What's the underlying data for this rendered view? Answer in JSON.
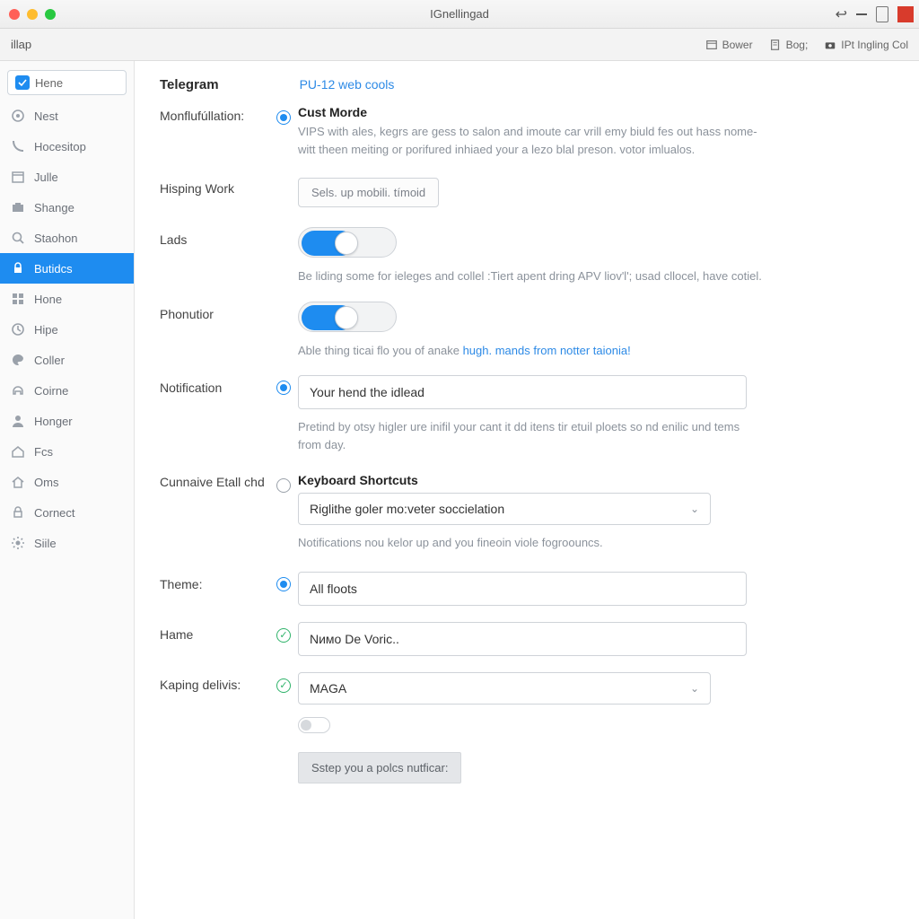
{
  "window": {
    "title": "IGnellingad"
  },
  "toolbar": {
    "brand": "illap",
    "buttons": {
      "bower": "Bower",
      "bog": "Bog;",
      "ingling": "IPt Ingling Col"
    }
  },
  "sidebar": {
    "search": "Hene",
    "items": [
      {
        "label": "Nest"
      },
      {
        "label": "Hocesitop"
      },
      {
        "label": "Julle"
      },
      {
        "label": "Shange"
      },
      {
        "label": "Staohon"
      },
      {
        "label": "Butidcs"
      },
      {
        "label": "Hone"
      },
      {
        "label": "Hipe"
      },
      {
        "label": "Coller"
      },
      {
        "label": "Coirne"
      },
      {
        "label": "Honger"
      },
      {
        "label": "Fcs"
      },
      {
        "label": "Oms"
      },
      {
        "label": "Cornect"
      },
      {
        "label": "Siile"
      }
    ]
  },
  "page": {
    "title": "Telegram",
    "link": "PU-12 web cools",
    "mode_label": "Monflufúllation:",
    "mode_title": "Cust Morde",
    "mode_desc": "VIPS with ales, kegrs are gess to salon and imoute car vrill emy biuld fes out hass nome-witt theen meiting or porifured inhiaed your a lezo blal preson. votor imlualos.",
    "hisping_label": "Hisping Work",
    "hisping_button": "Sels. up mobili. tímoid",
    "lads_label": "Lads",
    "lads_desc": "Be liding some for ieleges and collel :Tiert apent dring APV liov'l'; usad cllocel, have cotiel.",
    "phon_label": "Phonutior",
    "phon_desc_pre": "Able thing ticai flo you of anake ",
    "phon_desc_link": "hugh. mands from notter taionia!",
    "notif_label": "Notification",
    "notif_value": "Your hend the idlead",
    "notif_desc": "Pretind by otsy higler ure inifil your cant it dd itens tir etuil ploets so nd enilic und tems from day.",
    "kb_label": "Cunnaive Etall chd",
    "kb_title": "Keyboard Shortcuts",
    "kb_value": "Riglithe goler mo:veter soccielation",
    "kb_desc": "Notifications nou kelor up and you fineoin viole fogroouncs.",
    "theme_label": "Theme:",
    "theme_value": "All floots",
    "hame_label": "Hame",
    "hame_value": "Nимо De Voric..",
    "kaping_label": "Kaping delivis:",
    "kaping_value": "MAGA",
    "footer_button": "Sstep you a polcs nutficar:"
  }
}
